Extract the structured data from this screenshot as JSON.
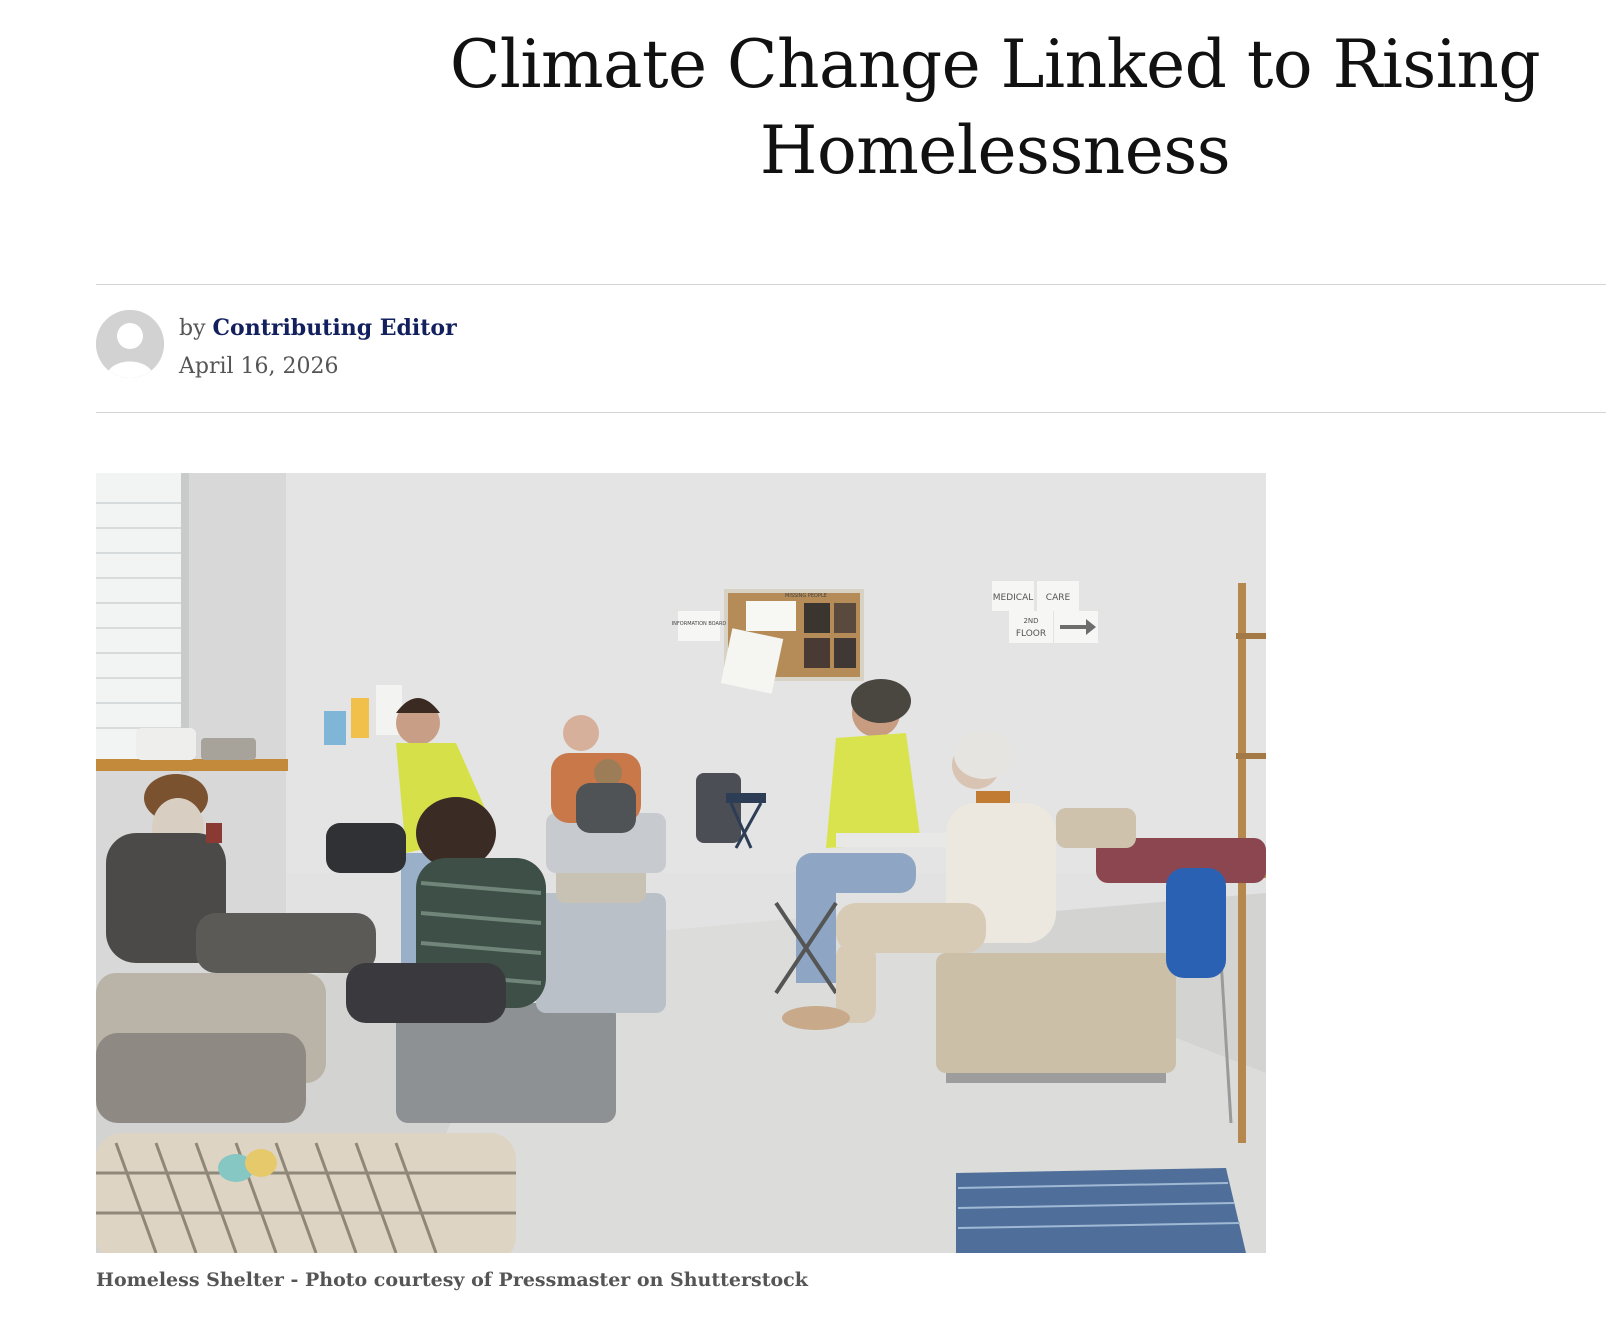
{
  "article": {
    "title": "Climate Change Linked to Rising Homelessness",
    "byline_prefix": "by",
    "author": "Contributing Editor",
    "date": "April 16, 2026"
  },
  "featured_image": {
    "caption": "Homeless Shelter - Photo courtesy of Pressmaster on Shutterstock",
    "wall_signs": {
      "info_board": "INFORMATION BOARD",
      "missing_people": "MISSING PEOPLE",
      "medical": "MEDICAL",
      "care": "CARE",
      "floor_number": "2ND",
      "floor": "FLOOR"
    }
  },
  "colors": {
    "author_link": "#13205e",
    "meta_text": "#555555",
    "divider": "#d4d4d4",
    "avatar": "#d2d2d2"
  }
}
